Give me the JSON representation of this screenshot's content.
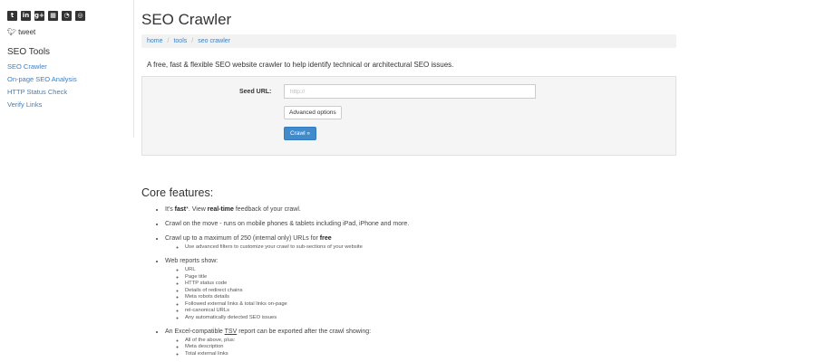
{
  "social": {
    "icons": [
      {
        "name": "twitter-icon",
        "glyph": "t"
      },
      {
        "name": "linkedin-icon",
        "glyph": "in"
      },
      {
        "name": "google-plus-icon",
        "glyph": "g+"
      },
      {
        "name": "delicious-icon",
        "glyph": "▦"
      },
      {
        "name": "rss-icon",
        "glyph": "◔"
      },
      {
        "name": "instagram-icon",
        "glyph": "◎"
      }
    ],
    "tweet_label": "tweet"
  },
  "sidebar": {
    "title": "SEO Tools",
    "links": [
      "SEO Crawler",
      "On-page SEO Analysis",
      "HTTP Status Check",
      "Verify Links"
    ]
  },
  "main": {
    "title": "SEO Crawler",
    "breadcrumb": [
      "home",
      "tools",
      "seo crawler"
    ],
    "breadcrumb_sep": "/",
    "intro": "A free, fast & flexible SEO website crawler to help identify technical or architectural SEO issues."
  },
  "form": {
    "seed_label": "Seed URL:",
    "seed_placeholder": "http://",
    "advanced_label": "Advanced options",
    "crawl_label": "Crawl »"
  },
  "features": {
    "title": "Core features:",
    "f1": {
      "pre": "It's ",
      "bold1": "fast",
      "mid": "*. View ",
      "bold2": "real-time",
      "post": " feedback of your crawl."
    },
    "f2": "Crawl on the move - runs on mobile phones & tablets including iPad, iPhone and more.",
    "f3": {
      "pre": "Crawl up to a maximum of 250 (internal only) URLs for ",
      "bold": "free",
      "sub": [
        "Use advanced filters to customize your crawl to sub-sections of your website"
      ]
    },
    "f4": {
      "text": "Web reports show:",
      "sub": [
        "URL",
        "Page title",
        "HTTP status code",
        "Details of redirect chains",
        "Meta robots details",
        "Followed external links & total links on-page",
        "rel-canonical URLs",
        "Any automatically detected SEO issues"
      ]
    },
    "f5": {
      "pre": "An Excel-compatible ",
      "u": "TSV",
      "post": " report can be exported after the crawl showing:",
      "sub": [
        "All of the above, plus:",
        "Meta description",
        "Total external links"
      ]
    }
  }
}
